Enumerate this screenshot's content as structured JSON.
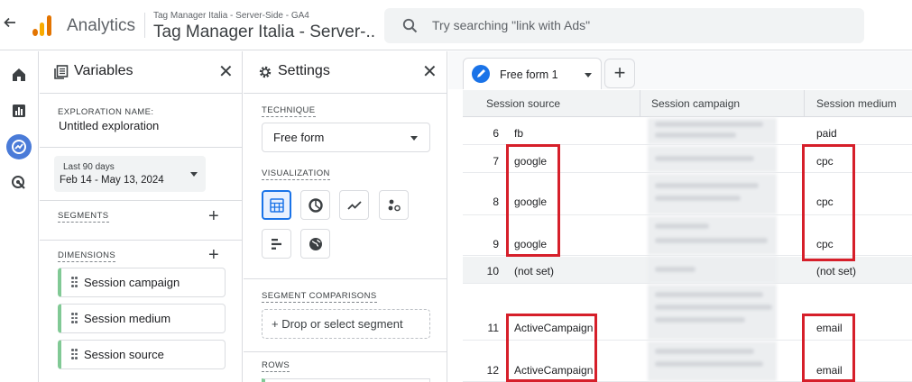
{
  "topbar": {
    "back_icon": "arrow-left-icon",
    "app_name": "Analytics",
    "account_path": "Tag Manager Italia - Server-Side - GA4",
    "property_name": "Tag Manager Italia - Server-...",
    "search_placeholder": "Try searching \"link with Ads\""
  },
  "rail": {
    "items": [
      "home-icon",
      "reports-icon",
      "explore-icon",
      "advertising-icon"
    ],
    "active_color": "#4a7bd8"
  },
  "variables": {
    "title": "Variables",
    "exploration_name_label": "EXPLORATION NAME:",
    "exploration_name": "Untitled exploration",
    "date_range_label": "Last 90 days",
    "date_range": "Feb 14 - May 13, 2024",
    "segments_label": "SEGMENTS",
    "dimensions_label": "DIMENSIONS",
    "dimensions": [
      "Session campaign",
      "Session medium",
      "Session source"
    ]
  },
  "settings": {
    "title": "Settings",
    "technique_label": "TECHNIQUE",
    "technique": "Free form",
    "visualization_label": "VISUALIZATION",
    "visualizations": [
      "table-icon",
      "donut-chart-icon",
      "line-chart-icon",
      "scatter-chart-icon",
      "bar-chart-icon",
      "geo-map-icon"
    ],
    "segment_comparisons_label": "SEGMENT COMPARISONS",
    "drop_segment": "Drop or select segment",
    "rows_label": "ROWS"
  },
  "canvas": {
    "tab_label": "Free form 1",
    "add_tab": "+",
    "columns": [
      "Session source",
      "Session campaign",
      "Session medium"
    ],
    "rows": [
      {
        "index": "6",
        "source": "fb",
        "medium": "paid"
      },
      {
        "index": "7",
        "source": "google",
        "medium": "cpc"
      },
      {
        "index": "8",
        "source": "google",
        "medium": "cpc"
      },
      {
        "index": "9",
        "source": "google",
        "medium": "cpc"
      },
      {
        "index": "10",
        "source": "(not set)",
        "medium": "(not set)"
      },
      {
        "index": "11",
        "source": "ActiveCampaign",
        "medium": "email"
      },
      {
        "index": "12",
        "source": "ActiveCampaign",
        "medium": "email"
      }
    ],
    "highlight_color": "#d61f2a"
  }
}
